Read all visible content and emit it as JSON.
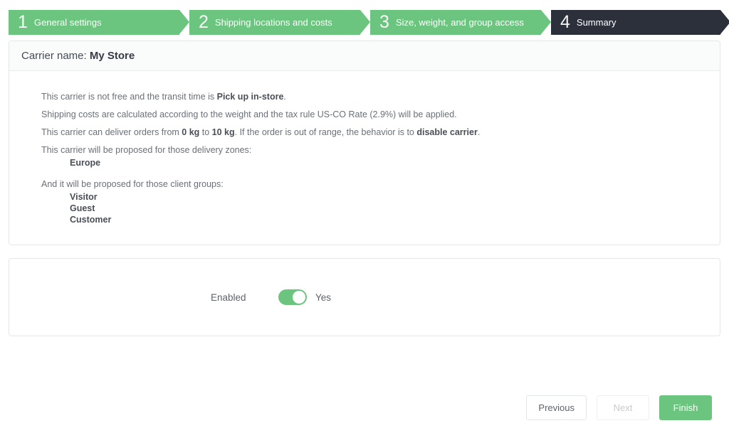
{
  "wizard": {
    "steps": [
      {
        "number": "1",
        "label": "General settings",
        "state": "done"
      },
      {
        "number": "2",
        "label": "Shipping locations and costs",
        "state": "done"
      },
      {
        "number": "3",
        "label": "Size, weight, and group access",
        "state": "done"
      },
      {
        "number": "4",
        "label": "Summary",
        "state": "active"
      }
    ]
  },
  "summary_panel": {
    "title_prefix": "Carrier name:",
    "carrier_name": "My Store",
    "line1": {
      "part1": "This carrier is not free and the transit time is ",
      "bold1": "Pick up in-store",
      "part2": "."
    },
    "line2": {
      "part1": "Shipping costs are calculated according to the weight and the tax rule US-CO Rate (2.9%) will be applied."
    },
    "line3": {
      "part1": "This carrier can deliver orders from ",
      "bold1": "0 kg",
      "part2": " to ",
      "bold2": "10 kg",
      "part3": ". If the order is out of range, the behavior is to ",
      "bold3": "disable carrier",
      "part4": "."
    },
    "zones_intro": "This carrier will be proposed for those delivery zones:",
    "zones": [
      "Europe"
    ],
    "groups_intro": "And it will be proposed for those client groups:",
    "groups": [
      "Visitor",
      "Guest",
      "Customer"
    ]
  },
  "enabled_panel": {
    "label": "Enabled",
    "value_text": "Yes",
    "toggle_state": "on"
  },
  "footer": {
    "previous_label": "Previous",
    "next_label": "Next",
    "finish_label": "Finish"
  },
  "colors": {
    "green": "#6cc57f",
    "dark": "#2b303a",
    "text": "#6a7078",
    "border": "#e4e7ea"
  }
}
